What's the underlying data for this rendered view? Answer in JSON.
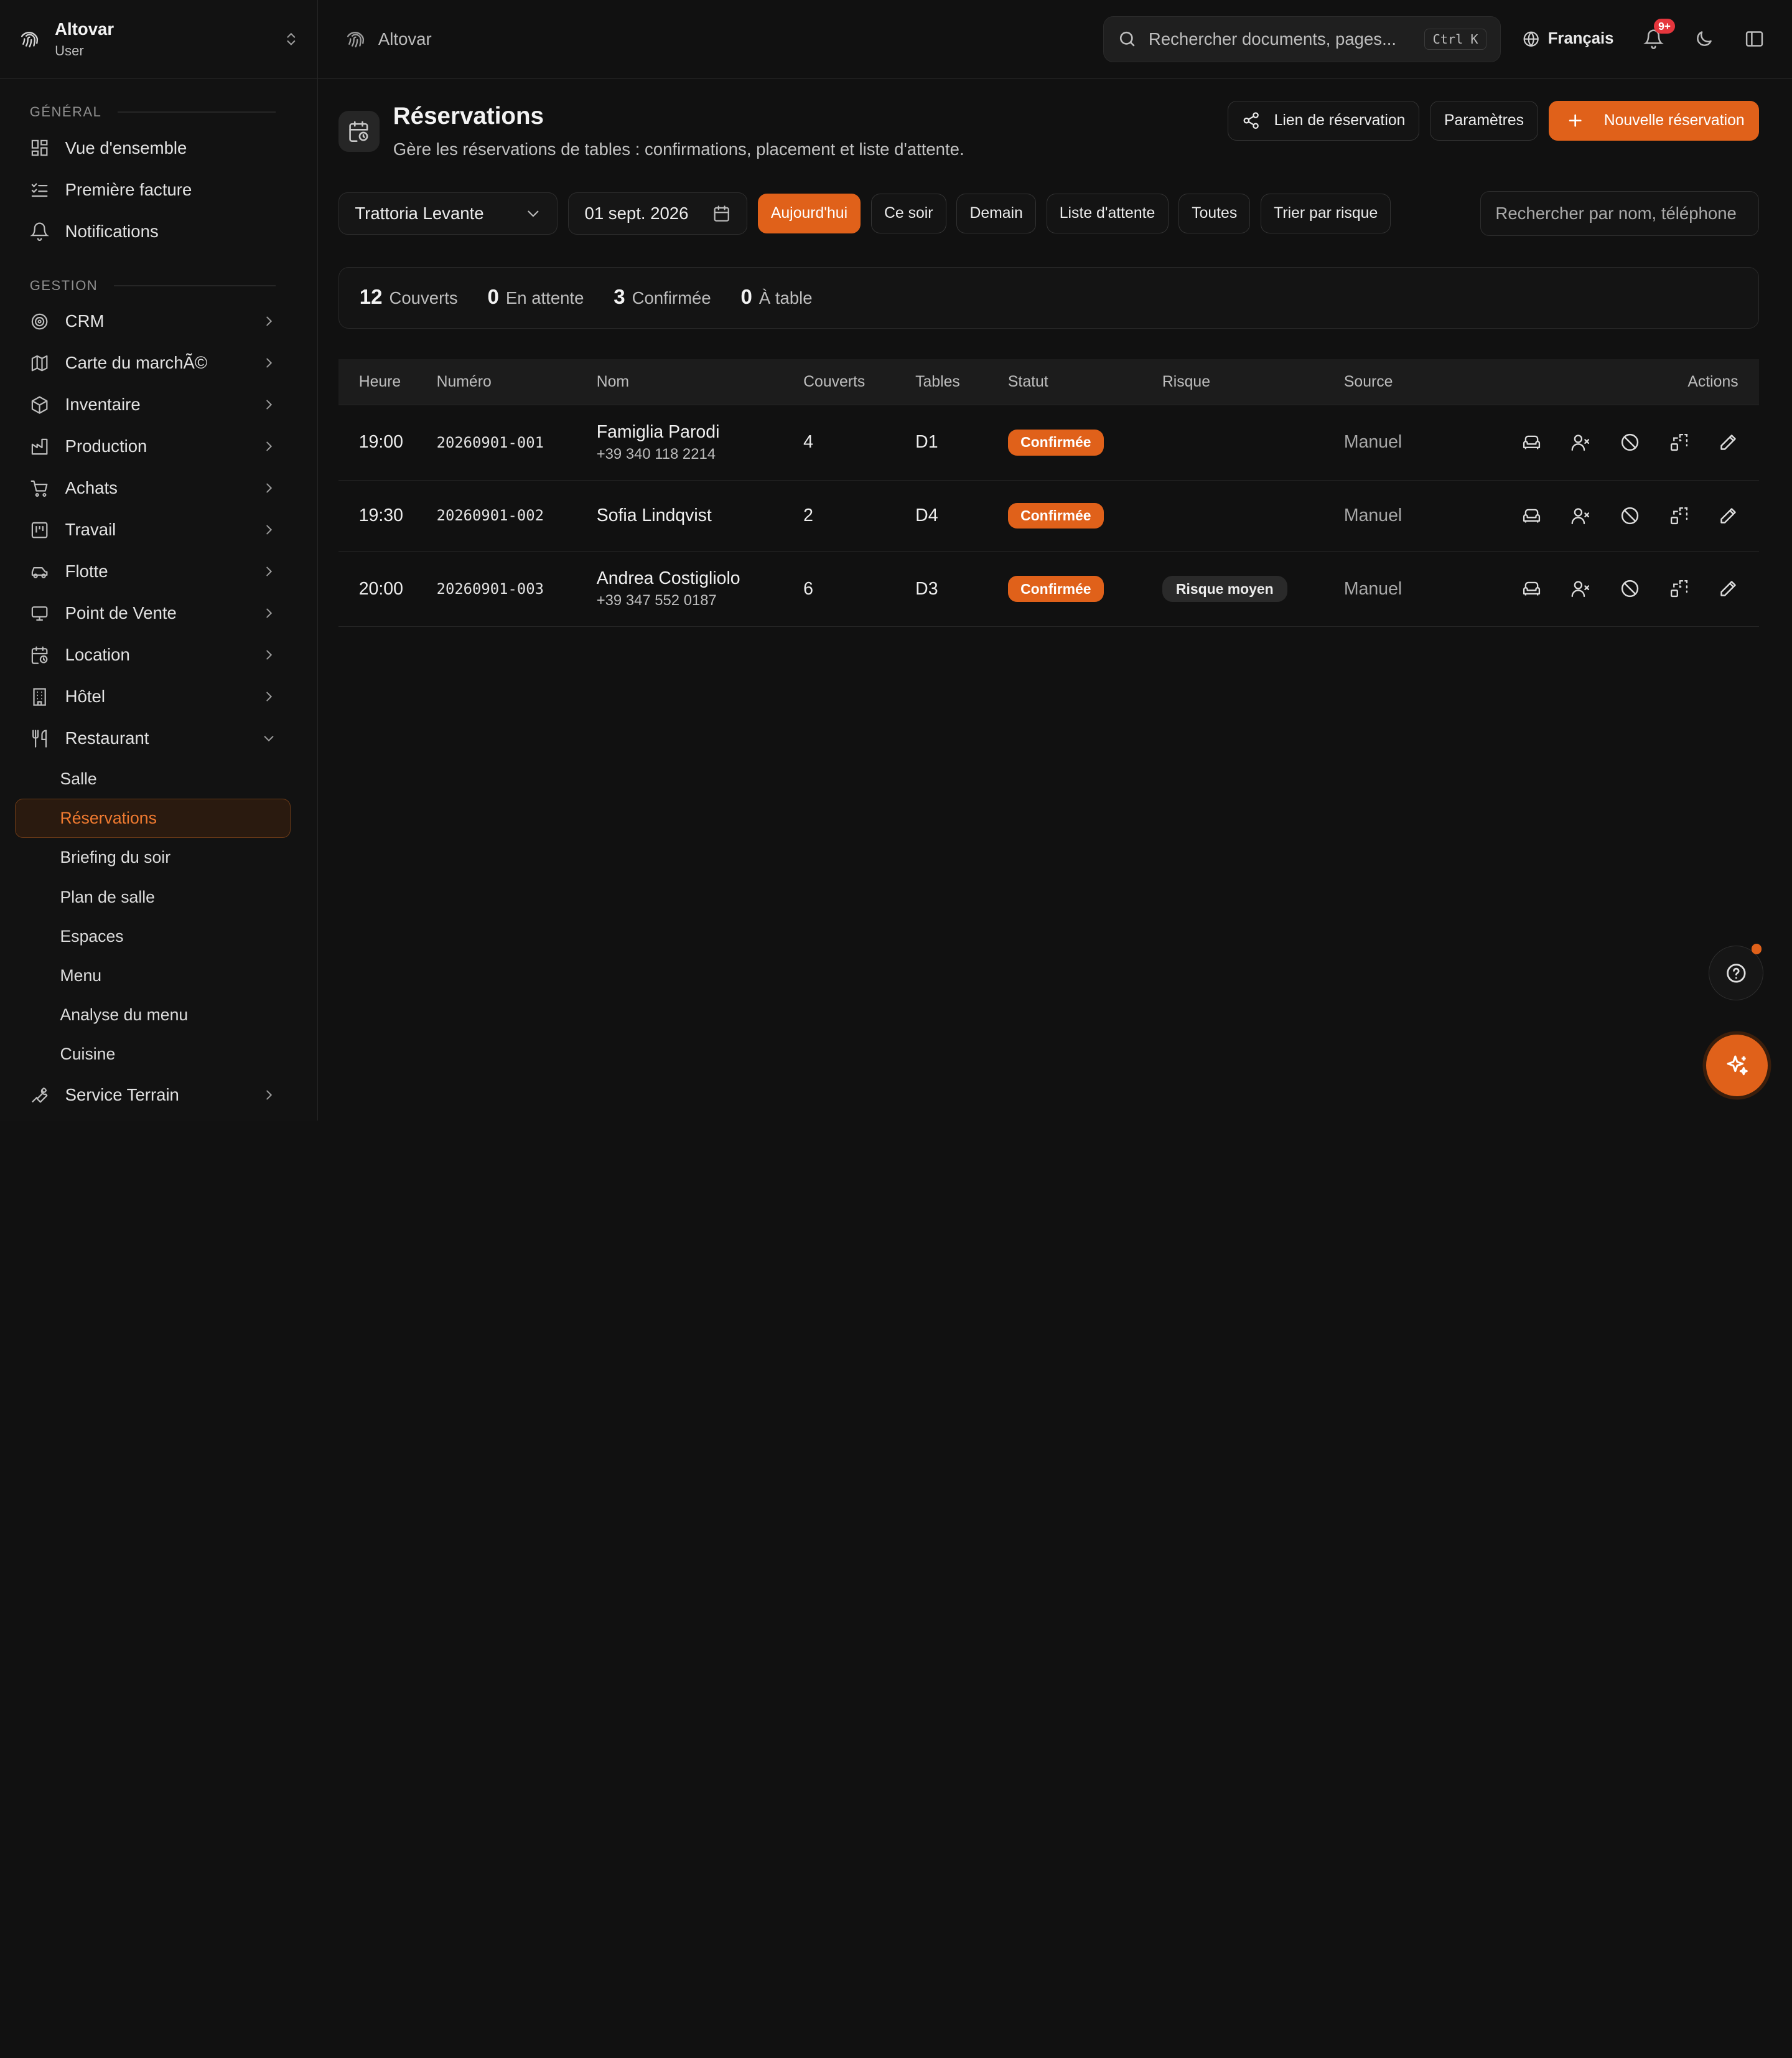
{
  "workspace": {
    "name": "Altovar",
    "role": "User"
  },
  "sidebar": {
    "section_general": "GÉNÉRAL",
    "general_items": [
      {
        "label": "Vue d'ensemble",
        "icon": "dashboard-icon"
      },
      {
        "label": "Première facture",
        "icon": "checklist-icon"
      },
      {
        "label": "Notifications",
        "icon": "bell-icon"
      }
    ],
    "section_gestion": "GESTION",
    "gestion_items": [
      {
        "label": "CRM",
        "icon": "target-icon"
      },
      {
        "label": "Carte du marchÃ©",
        "icon": "map-icon"
      },
      {
        "label": "Inventaire",
        "icon": "box-icon"
      },
      {
        "label": "Production",
        "icon": "factory-icon"
      },
      {
        "label": "Achats",
        "icon": "cart-icon"
      },
      {
        "label": "Travail",
        "icon": "kanban-icon"
      },
      {
        "label": "Flotte",
        "icon": "car-icon"
      },
      {
        "label": "Point de Vente",
        "icon": "monitor-icon"
      },
      {
        "label": "Location",
        "icon": "calendar-clock-icon"
      },
      {
        "label": "Hôtel",
        "icon": "building-icon"
      },
      {
        "label": "Restaurant",
        "icon": "utensils-icon"
      }
    ],
    "restaurant_sub": [
      "Salle",
      "Réservations",
      "Briefing du soir",
      "Plan de salle",
      "Espaces",
      "Menu",
      "Analyse du menu",
      "Cuisine"
    ],
    "last_item": {
      "label": "Service Terrain",
      "icon": "wrench-icon"
    }
  },
  "topbar": {
    "breadcrumb": "Altovar",
    "search_placeholder": "Rechercher documents, pages...",
    "search_shortcut": "Ctrl K",
    "language": "Français",
    "notifications_badge": "9+"
  },
  "page": {
    "title": "Réservations",
    "subtitle": "Gère les réservations de tables : confirmations, placement et liste d'attente.",
    "actions": {
      "booking_link": "Lien de réservation",
      "settings": "Paramètres",
      "new_booking": "Nouvelle réservation"
    }
  },
  "filters": {
    "restaurant": "Trattoria Levante",
    "date": "01 sept. 2026",
    "chips": [
      "Aujourd'hui",
      "Ce soir",
      "Demain",
      "Liste d'attente",
      "Toutes",
      "Trier par risque"
    ],
    "active_chip": "Aujourd'hui",
    "search_placeholder": "Rechercher par nom, téléphone"
  },
  "stats": [
    {
      "value": "12",
      "label": "Couverts"
    },
    {
      "value": "0",
      "label": "En attente"
    },
    {
      "value": "3",
      "label": "Confirmée"
    },
    {
      "value": "0",
      "label": "À table"
    }
  ],
  "table": {
    "columns": [
      "Heure",
      "Numéro",
      "Nom",
      "Couverts",
      "Tables",
      "Statut",
      "Risque",
      "Source",
      "Actions"
    ],
    "rows": [
      {
        "time": "19:00",
        "number": "20260901-001",
        "name": "Famiglia Parodi",
        "phone": "+39 340 118 2214",
        "covers": "4",
        "table": "D1",
        "status": "Confirmée",
        "risk": "",
        "source": "Manuel"
      },
      {
        "time": "19:30",
        "number": "20260901-002",
        "name": "Sofia Lindqvist",
        "phone": "",
        "covers": "2",
        "table": "D4",
        "status": "Confirmée",
        "risk": "",
        "source": "Manuel"
      },
      {
        "time": "20:00",
        "number": "20260901-003",
        "name": "Andrea Costigliolo",
        "phone": "+39 347 552 0187",
        "covers": "6",
        "table": "D3",
        "status": "Confirmée",
        "risk": "Risque moyen",
        "source": "Manuel"
      }
    ],
    "row_actions": [
      "seat-icon",
      "no-show-icon",
      "cancel-icon",
      "move-table-icon",
      "edit-icon"
    ]
  },
  "colors": {
    "accent": "#e0611a",
    "background": "#111111",
    "badge": "#e5363d"
  }
}
